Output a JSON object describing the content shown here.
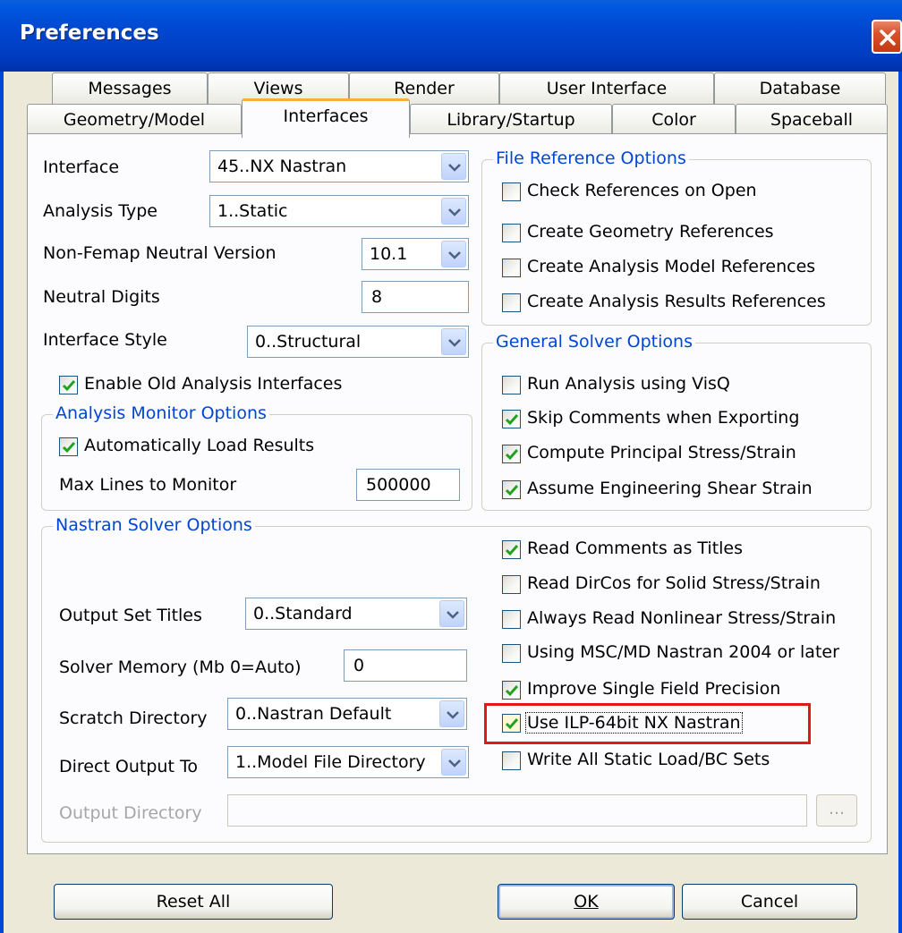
{
  "window": {
    "title": "Preferences"
  },
  "tabs_row1": [
    "Messages",
    "Views",
    "Render",
    "User Interface",
    "Database"
  ],
  "tabs_row2": [
    "Geometry/Model",
    "Interfaces",
    "Library/Startup",
    "Color",
    "Spaceball"
  ],
  "active_tab": "Interfaces",
  "left": {
    "interface_label": "Interface",
    "interface_value": "45..NX Nastran",
    "analysis_type_label": "Analysis Type",
    "analysis_type_value": "1..Static",
    "neutral_version_label": "Non-Femap Neutral Version",
    "neutral_version_value": "10.1",
    "neutral_digits_label": "Neutral Digits",
    "neutral_digits_value": "8",
    "interface_style_label": "Interface Style",
    "interface_style_value": "0..Structural",
    "enable_old_label": "Enable Old Analysis Interfaces",
    "enable_old_checked": true
  },
  "monitor": {
    "title": "Analysis Monitor Options",
    "auto_load_label": "Automatically Load Results",
    "auto_load_checked": true,
    "max_lines_label": "Max Lines to Monitor",
    "max_lines_value": "500000"
  },
  "file_ref": {
    "title": "File Reference Options",
    "items": [
      {
        "label": "Check References on Open",
        "checked": false
      },
      {
        "label": "Create Geometry References",
        "checked": false
      },
      {
        "label": "Create Analysis Model References",
        "checked": false
      },
      {
        "label": "Create Analysis Results References",
        "checked": false
      }
    ]
  },
  "general": {
    "title": "General Solver Options",
    "items": [
      {
        "label": "Run Analysis using VisQ",
        "checked": false
      },
      {
        "label": "Skip Comments when Exporting",
        "checked": true
      },
      {
        "label": "Compute Principal Stress/Strain",
        "checked": true
      },
      {
        "label": "Assume Engineering Shear Strain",
        "checked": true
      }
    ]
  },
  "nastran": {
    "title": "Nastran Solver Options",
    "output_set_titles_label": "Output Set Titles",
    "output_set_titles_value": "0..Standard",
    "solver_memory_label": "Solver Memory (Mb 0=Auto)",
    "solver_memory_value": "0",
    "scratch_label": "Scratch Directory",
    "scratch_value": "0..Nastran Default",
    "direct_output_label": "Direct Output To",
    "direct_output_value": "1..Model File Directory",
    "output_dir_label": "Output Directory",
    "output_dir_value": "",
    "browse_label": "...",
    "items": [
      {
        "label": "Read Comments as Titles",
        "checked": true
      },
      {
        "label": "Read DirCos for Solid Stress/Strain",
        "checked": false
      },
      {
        "label": "Always Read Nonlinear Stress/Strain",
        "checked": false
      },
      {
        "label": "Using MSC/MD Nastran 2004 or later",
        "checked": false
      },
      {
        "label": "Improve Single Field Precision",
        "checked": true
      },
      {
        "label": "Use ILP-64bit NX Nastran",
        "checked": true
      },
      {
        "label": "Write All Static Load/BC Sets",
        "checked": false
      }
    ]
  },
  "buttons": {
    "reset": "Reset All",
    "ok": "OK",
    "cancel": "Cancel"
  }
}
